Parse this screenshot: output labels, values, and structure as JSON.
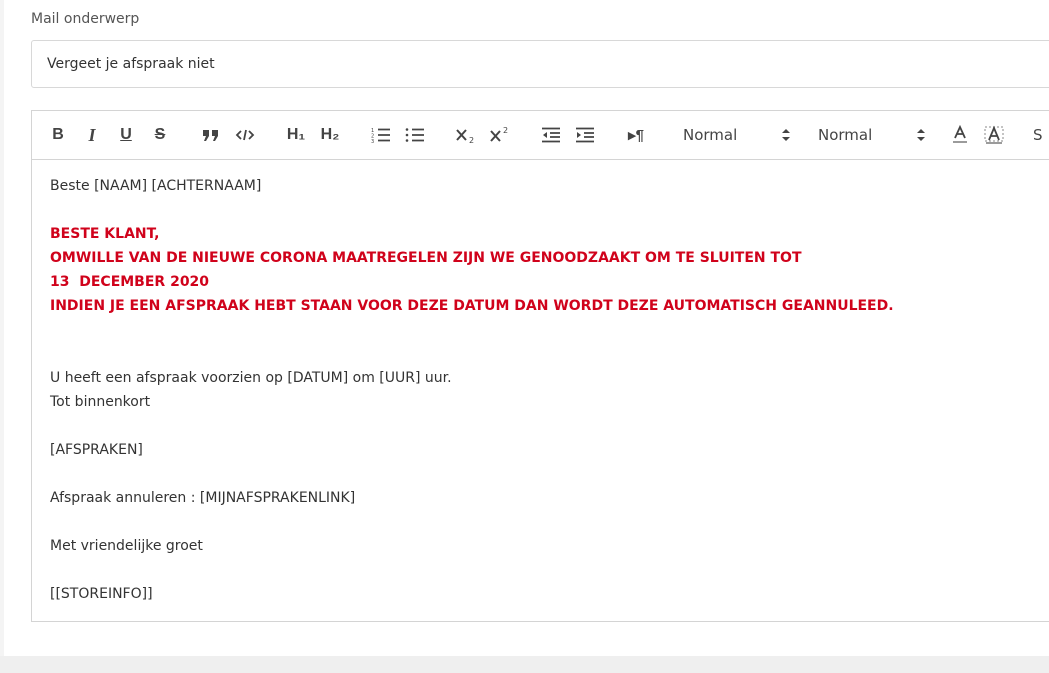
{
  "subject": {
    "label": "Mail onderwerp",
    "value": "Vergeet je afspraak niet"
  },
  "toolbar": {
    "bold": "B",
    "italic": "I",
    "underline": "U",
    "strike": "S",
    "header1": "H₁",
    "header2": "H₂",
    "paragraph_mark": "▸¶",
    "size_picker": "Normal",
    "header_picker": "Normal",
    "overflow": "S"
  },
  "body": {
    "greeting": "Beste [NAAM] [ACHTERNAAM]",
    "notice": [
      "BESTE KLANT,",
      "OMWILLE VAN DE NIEUWE CORONA MAATREGELEN ZIJN WE GENOODZAAKT OM TE SLUITEN TOT",
      "13  DECEMBER 2020",
      "INDIEN JE EEN AFSPRAAK HEBT STAAN VOOR DEZE DATUM DAN WORDT DEZE AUTOMATISCH GEANNULEED."
    ],
    "appointment_line": "U heeft een afspraak voorzien op [DATUM] om [UUR] uur.",
    "see_you": "Tot binnenkort",
    "appointments_tag": "[AFSPRAKEN]",
    "cancel_line": "Afspraak annuleren : [MIJNAFSPRAKENLINK]",
    "closing": "Met vriendelijke groet",
    "store_tag": "[[STOREINFO]]"
  },
  "colors": {
    "notice_red": "#d0021b",
    "border": "#d4d4d4",
    "toolbar_icon": "#444444"
  }
}
